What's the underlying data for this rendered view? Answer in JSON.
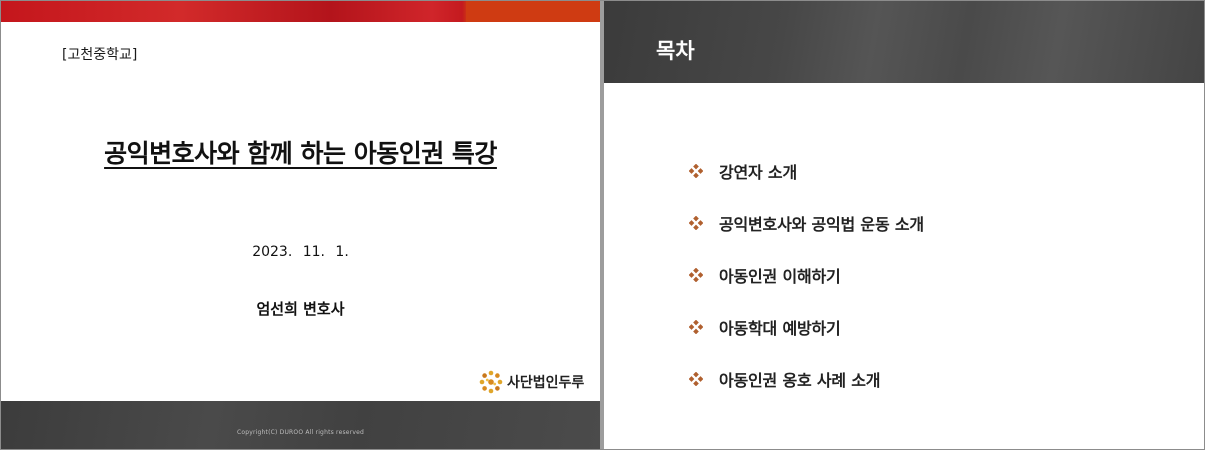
{
  "left_slide": {
    "school": "[고천중학교]",
    "title": "공익변호사와 함께 하는 아동인권 특강",
    "date": "2023.  11.  1.",
    "speaker": "엄선희 변호사",
    "org_name": "사단법인두루",
    "copyright": "Copyright(C) DUROO All rights reserved"
  },
  "right_slide": {
    "title": "목차",
    "items": [
      {
        "label": "강연자 소개"
      },
      {
        "label": "공익변호사와 공익법 운동 소개"
      },
      {
        "label": "아동인권 이해하기"
      },
      {
        "label": "아동학대 예방하기"
      },
      {
        "label": "아동인권 옹호 사례 소개"
      }
    ]
  },
  "colors": {
    "accent_red": "#c4161c",
    "accent_orange": "#cf3b12",
    "header_gray": "#474747",
    "bullet_brown": "#b0602f",
    "logo_gold": "#e0a62a"
  },
  "icons": {
    "bullet": "diamond-quad-icon",
    "logo": "duroo-dots-logo"
  }
}
